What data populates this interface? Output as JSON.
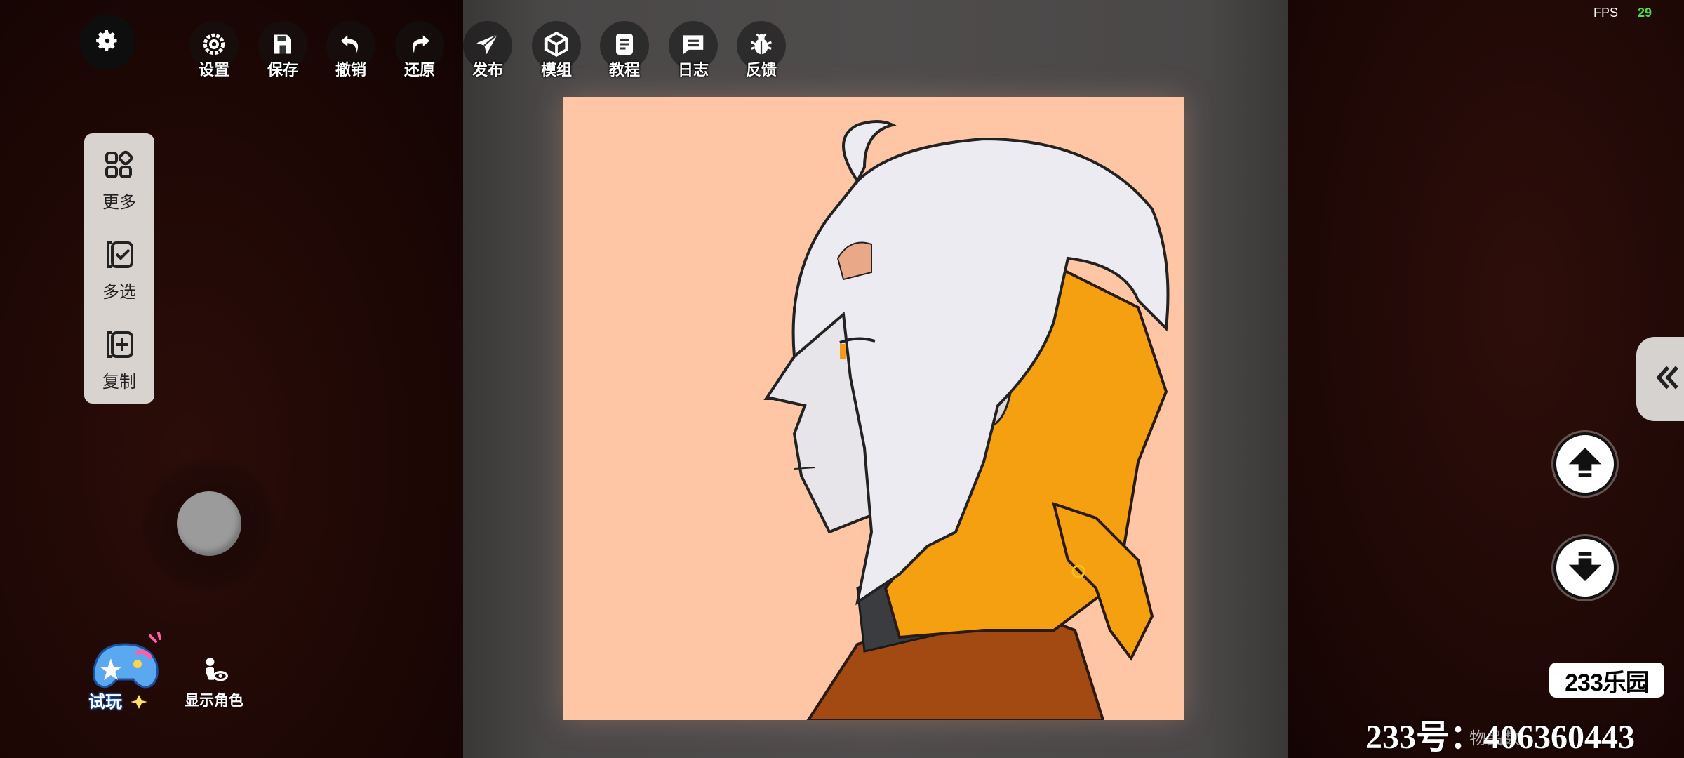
{
  "toolbar": {
    "items": [
      {
        "label": "设置",
        "icon": "gear-icon"
      },
      {
        "label": "保存",
        "icon": "save-icon"
      },
      {
        "label": "撤销",
        "icon": "undo-icon"
      },
      {
        "label": "还原",
        "icon": "redo-icon"
      },
      {
        "label": "发布",
        "icon": "send-icon"
      },
      {
        "label": "模组",
        "icon": "cube-icon"
      },
      {
        "label": "教程",
        "icon": "book-icon"
      },
      {
        "label": "日志",
        "icon": "log-icon"
      },
      {
        "label": "反馈",
        "icon": "bug-icon"
      }
    ]
  },
  "status": {
    "fps_label": "FPS",
    "fps_value": "29"
  },
  "side_panel": {
    "items": [
      {
        "label": "更多",
        "icon": "grid-icon"
      },
      {
        "label": "多选",
        "icon": "multi-select-icon"
      },
      {
        "label": "复制",
        "icon": "copy-icon"
      }
    ]
  },
  "bottom_left": {
    "play_label": "试玩",
    "show_character_label": "显示角色"
  },
  "watermark": {
    "logo_text": "233乐园",
    "user_id": "233号：406360443",
    "item_count_text": "物品数"
  },
  "colors": {
    "canvas_bg": "#ffc6a6",
    "hair_white": "#eceaf0",
    "hair_orange": "#f5a010",
    "fps_green": "#4cdc4c"
  }
}
